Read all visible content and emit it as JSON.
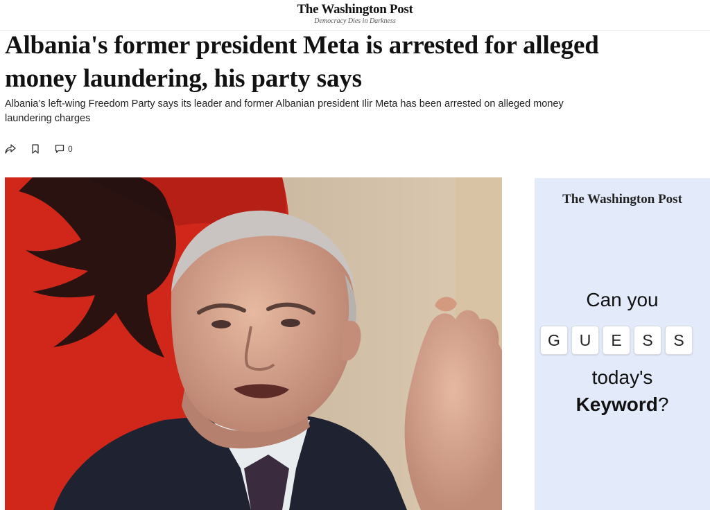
{
  "masthead": {
    "logo": "The Washington Post",
    "tagline": "Democracy Dies in Darkness"
  },
  "article": {
    "headline": "Albania's former president Meta is arrested for alleged money laundering, his party says",
    "dek": "Albania’s left-wing Freedom Party says its leader and former Albanian president Ilir Meta has been arrested on alleged money laundering charges",
    "comment_count": "0"
  },
  "actions": {
    "share_icon": "share-icon",
    "bookmark_icon": "bookmark-icon",
    "comment_icon": "comment-icon"
  },
  "photo": {
    "subject": "photo-of-man-speaking-in-front-of-albanian-flag"
  },
  "ad": {
    "logo": "The Washington Post",
    "line1": "Can you",
    "tiles": [
      "G",
      "U",
      "E",
      "S",
      "S"
    ],
    "line2": "today's",
    "keyword": "Keyword",
    "question_mark": "?"
  },
  "colors": {
    "ad_background": "#e3ebfa",
    "flag_red": "#d1271b"
  }
}
